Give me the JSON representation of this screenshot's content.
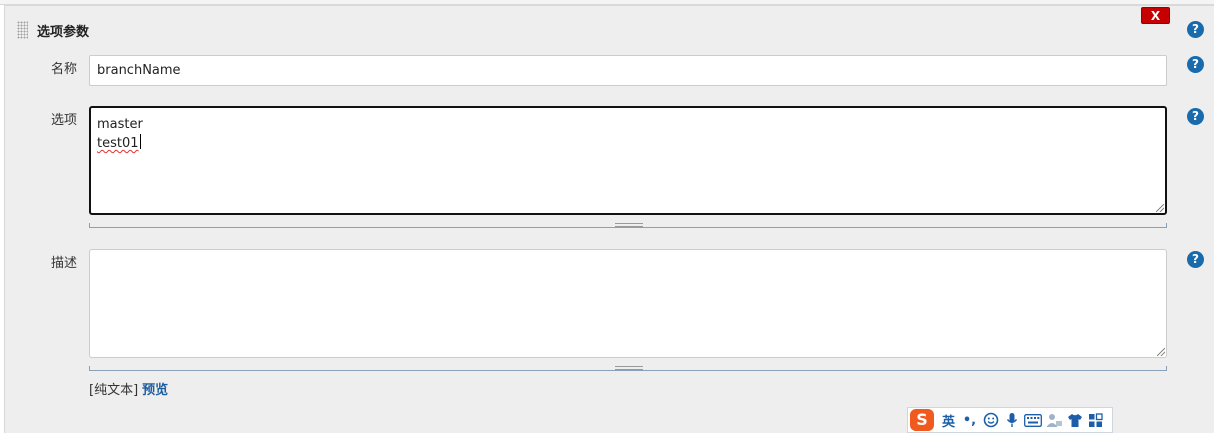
{
  "section": {
    "title": "选项参数",
    "delete_label": "X",
    "help": "?"
  },
  "fields": {
    "name": {
      "label": "名称",
      "value": "branchName"
    },
    "choices": {
      "label": "选项",
      "line1": "master",
      "line2": "test01"
    },
    "description": {
      "label": "描述",
      "value": ""
    }
  },
  "format": {
    "plain": "[纯文本]",
    "preview": "预览"
  },
  "ime": {
    "logo": "S",
    "mode": "英",
    "punct": "•,",
    "icons": [
      "smiley-icon",
      "microphone-icon",
      "keyboard-icon",
      "user-tool-icon",
      "tshirt-icon",
      "grid-icon"
    ]
  },
  "colors": {
    "accent": "#1a6bab",
    "delete": "#c60000",
    "ime_logo": "#f05a1e"
  }
}
